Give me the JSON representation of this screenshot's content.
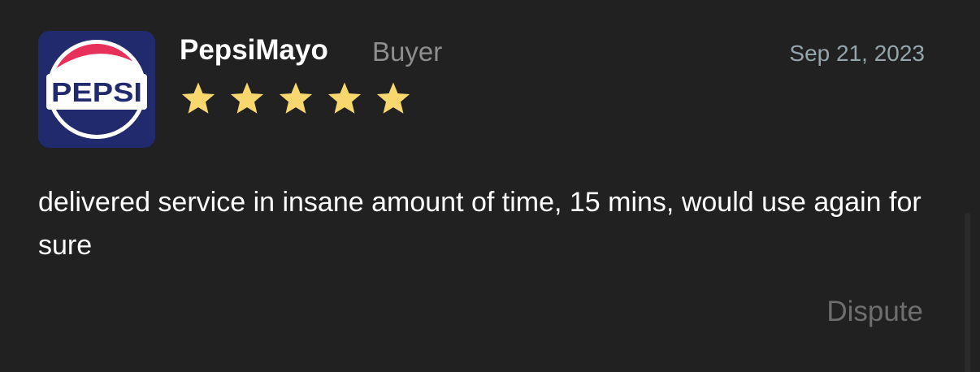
{
  "review": {
    "user": {
      "name": "PepsiMayo",
      "role": "Buyer",
      "avatar_text": "PEPSI"
    },
    "date": "Sep 21, 2023",
    "rating": 5,
    "rating_max": 5,
    "text": "delivered service in insane amount of time, 15 mins, would use again for sure",
    "dispute_label": "Dispute"
  },
  "colors": {
    "background": "#212121",
    "star": "#f8d86e",
    "muted_text": "#8e8e8e",
    "date_text": "#93a6ab",
    "dispute_text": "#6e6e6e",
    "pepsi_navy": "#222a6e",
    "pepsi_red": "#e8315a"
  },
  "icons": {
    "star": "star-icon",
    "avatar": "pepsi-logo-avatar"
  }
}
